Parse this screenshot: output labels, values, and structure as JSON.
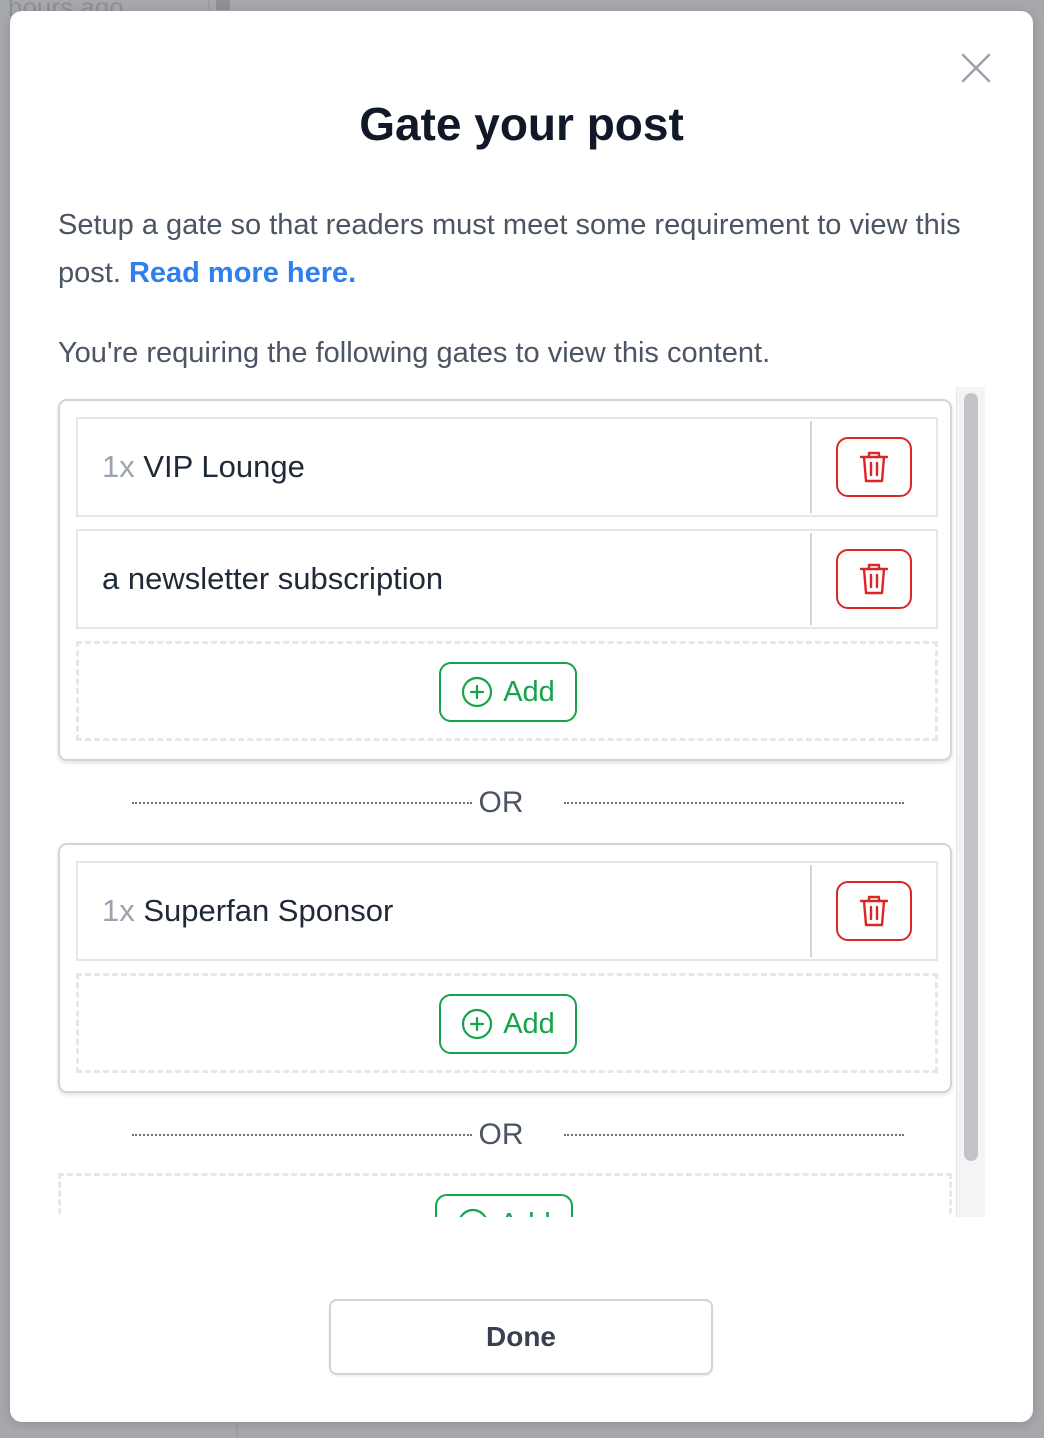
{
  "background": {
    "hint_text": "hours ago"
  },
  "modal": {
    "title": "Gate your post",
    "intro_text": "Setup a gate so that readers must meet some requirement to view this post. ",
    "read_more_link": "Read more here.",
    "requirement_text": "You're requiring the following gates to view this content.",
    "done_label": "Done"
  },
  "groups": [
    {
      "gates": [
        {
          "qty": "1x",
          "name": "VIP Lounge"
        },
        {
          "qty": "",
          "name": "a newsletter subscription"
        }
      ],
      "add_label": "Add"
    },
    {
      "gates": [
        {
          "qty": "1x",
          "name": "Superfan Sponsor"
        }
      ],
      "add_label": "Add"
    },
    {
      "gates": [],
      "add_label": "Add"
    }
  ],
  "separator_label": "OR",
  "icons": {
    "close": "close-icon",
    "delete": "trash-icon",
    "add": "plus-circle-icon"
  },
  "colors": {
    "delete": "#dc2626",
    "add": "#16a34a",
    "link": "#2f7ff0",
    "title": "#111827"
  }
}
